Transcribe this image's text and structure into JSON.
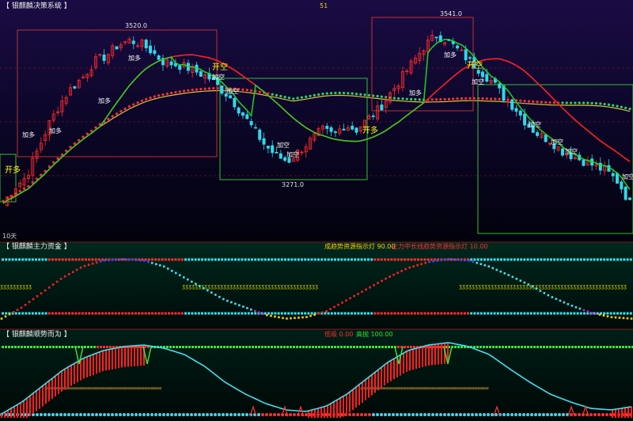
{
  "panels": {
    "main": {
      "title": "【 银麒麟决策系统 】",
      "indicator_value": "51",
      "period": "10天",
      "colors": {
        "bg_top": "#120a3a",
        "bg_bottom": "#000010",
        "up": "#ff2a2a",
        "down": "#30d8e8",
        "ma_fast": "#ff2020",
        "ma_slow": "#22dd22",
        "ma_long": "#d8c040",
        "box_red": "#c03030",
        "box_green": "#30c030"
      }
    },
    "fund": {
      "title": "【 银麒麟主力资金 】",
      "legend": [
        {
          "text": "成趋势资源指示灯 90.00",
          "color": "#ffd000"
        },
        {
          "text": "主力中长线趋势资源指示灯 10.00",
          "color": "#ff3030"
        }
      ]
    },
    "trend": {
      "title": "【 银麒麟顺势而为 】",
      "legend": [
        {
          "text": "低吸 0.00",
          "color": "#ff3030"
        },
        {
          "text": "高抛 100.00",
          "color": "#30e030"
        }
      ]
    }
  },
  "chart_data": [
    {
      "type": "candlestick",
      "title": "银麒麟决策系统",
      "price_labels": [
        {
          "text": "3520.0",
          "kind": "high"
        },
        {
          "text": "3271.0",
          "kind": "low"
        },
        {
          "text": "3541.0",
          "kind": "high"
        }
      ],
      "annotations": [
        {
          "text": "开多",
          "color": "#ffff00"
        },
        {
          "text": "加多",
          "color": "#ffffff"
        },
        {
          "text": "加多",
          "color": "#ffffff"
        },
        {
          "text": "加多",
          "color": "#ffffff"
        },
        {
          "text": "加多",
          "color": "#ffffff"
        },
        {
          "text": "开空",
          "color": "#ffff00"
        },
        {
          "text": "加空",
          "color": "#ffffff"
        },
        {
          "text": "加空",
          "color": "#ffffff"
        },
        {
          "text": "加空",
          "color": "#ffffff"
        },
        {
          "text": "加空",
          "color": "#ffffff"
        },
        {
          "text": "开多",
          "color": "#ffff00"
        },
        {
          "text": "加多",
          "color": "#ffffff"
        },
        {
          "text": "加多",
          "color": "#ffffff"
        },
        {
          "text": "开空",
          "color": "#ffff00"
        },
        {
          "text": "加空",
          "color": "#ffffff"
        },
        {
          "text": "加空",
          "color": "#ffffff"
        },
        {
          "text": "加空",
          "color": "#ffffff"
        },
        {
          "text": "加空",
          "color": "#ffffff"
        },
        {
          "text": "加空",
          "color": "#ffffff"
        }
      ],
      "close_path": [
        3200,
        3230,
        3250,
        3300,
        3350,
        3390,
        3420,
        3440,
        3470,
        3480,
        3500,
        3510,
        3505,
        3490,
        3470,
        3465,
        3460,
        3450,
        3440,
        3420,
        3400,
        3370,
        3340,
        3310,
        3290,
        3280,
        3300,
        3320,
        3340,
        3330,
        3350,
        3340,
        3360,
        3380,
        3410,
        3440,
        3470,
        3500,
        3520,
        3510,
        3490,
        3470,
        3450,
        3430,
        3400,
        3380,
        3350,
        3330,
        3320,
        3300,
        3290,
        3280,
        3270,
        3260,
        3240,
        3200
      ],
      "ylim": [
        3150,
        3560
      ]
    },
    {
      "type": "line",
      "title": "银麒麟主力资金",
      "series": [
        {
          "name": "成趋势资源指示灯",
          "values": [
            10,
            25,
            45,
            65,
            80,
            88,
            90,
            88,
            80,
            65,
            50,
            35,
            25,
            15,
            10,
            12,
            20,
            35,
            50,
            65,
            78,
            86,
            90,
            88,
            80,
            68,
            55,
            40,
            28,
            18,
            12,
            10
          ]
        },
        {
          "name": "主力中长线趋势资源指示灯",
          "values": [
            10,
            10,
            10,
            10,
            10,
            10,
            10,
            10,
            10,
            10,
            10,
            10,
            10,
            10,
            10,
            10,
            10,
            10,
            10,
            10,
            10,
            10,
            10,
            10,
            10,
            10,
            10,
            10,
            10,
            10,
            10,
            10
          ]
        }
      ],
      "ylim": [
        0,
        100
      ]
    },
    {
      "type": "line",
      "title": "银麒麟顺势而为",
      "series": [
        {
          "name": "低吸",
          "values": [
            5,
            20,
            40,
            60,
            75,
            85,
            90,
            92,
            88,
            80,
            65,
            45,
            30,
            18,
            10,
            8,
            15,
            30,
            50,
            70,
            85,
            92,
            95,
            90,
            80,
            62,
            45,
            30,
            20,
            12,
            10,
            14
          ]
        },
        {
          "name": "高抛",
          "values": [
            100,
            100,
            100,
            100,
            100,
            100,
            100,
            100,
            100,
            100,
            100,
            100,
            100,
            100,
            100,
            100,
            100,
            100,
            100,
            100,
            100,
            100,
            100,
            100,
            100,
            100,
            100,
            100,
            100,
            100,
            100,
            100
          ]
        }
      ],
      "ylim": [
        0,
        100
      ]
    }
  ]
}
